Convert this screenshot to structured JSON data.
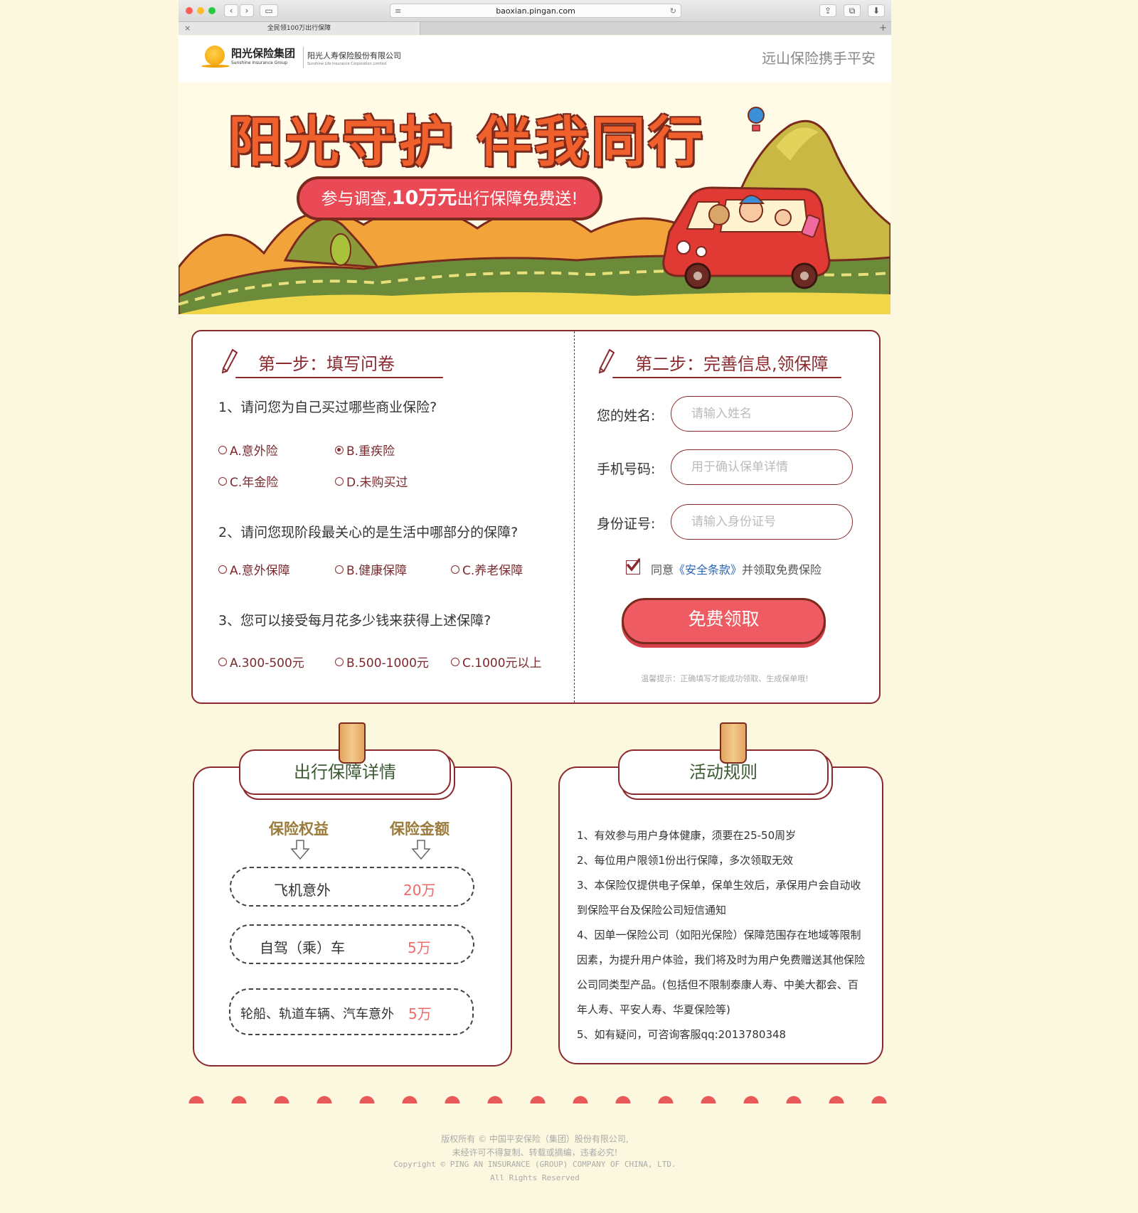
{
  "browser": {
    "address": "baoxian.pingan.com",
    "tab_title": "全民领100万出行保障",
    "tab_close": "×",
    "new_tab": "+"
  },
  "header": {
    "logo_name": "阳光保险集团",
    "logo_name_en": "Sunshine Insurance Group",
    "company": "阳光人寿保险股份有限公司",
    "company_en": "Sunshine Life Insurance Corporation Limited",
    "slogan": "远山保险携手平安"
  },
  "banner": {
    "title": "阳光守护 伴我同行",
    "pill_prefix": "参与调查,",
    "pill_amount": "10万元",
    "pill_suffix": "出行保障免费送!"
  },
  "step1": {
    "title": "第一步：填写问卷",
    "questions": [
      {
        "text": "1、请问您为自己买过哪些商业保险?",
        "options": [
          {
            "label": "A.意外险",
            "selected": false
          },
          {
            "label": "B.重疾险",
            "selected": true
          },
          {
            "label": "C.年金险",
            "selected": false
          },
          {
            "label": "D.未购买过",
            "selected": false
          }
        ]
      },
      {
        "text": "2、请问您现阶段最关心的是生活中哪部分的保障?",
        "options": [
          {
            "label": "A.意外保障",
            "selected": false
          },
          {
            "label": "B.健康保障",
            "selected": false
          },
          {
            "label": "C.养老保障",
            "selected": false
          }
        ]
      },
      {
        "text": "3、您可以接受每月花多少钱来获得上述保障?",
        "options": [
          {
            "label": "A.300-500元",
            "selected": false
          },
          {
            "label": "B.500-1000元",
            "selected": false
          },
          {
            "label": "C.1000元以上",
            "selected": false
          }
        ]
      }
    ]
  },
  "step2": {
    "title": "第二步：完善信息,领保障",
    "fields": [
      {
        "label": "您的姓名:",
        "value": "",
        "placeholder": "请输入姓名"
      },
      {
        "label": "手机号码:",
        "value": "",
        "placeholder": "用于确认保单详情"
      },
      {
        "label": "身份证号:",
        "value": "",
        "placeholder": "请输入身份证号"
      }
    ],
    "agree_prefix": "同意",
    "agree_link": "《安全条款》",
    "agree_suffix": "并领取免费保险",
    "agree_checked": true,
    "button": "免费领取",
    "tip": "温馨提示：正确填写才能成功领取、生成保单哦!"
  },
  "details": {
    "title": "出行保障详情",
    "col_benefit": "保险权益",
    "col_amount": "保险金额",
    "items": [
      {
        "name": "飞机意外",
        "amount": "20万"
      },
      {
        "name": "自驾（乘）车",
        "amount": "5万"
      },
      {
        "name": "轮船、轨道车辆、汽车意外",
        "amount": "5万"
      }
    ]
  },
  "rules": {
    "title": "活动规则",
    "lines": [
      "1、有效参与用户身体健康，须要在25-50周岁",
      "2、每位用户限领1份出行保障，多次领取无效",
      "3、本保险仅提供电子保单，保单生效后，承保用户会自动收到保险平台及保险公司短信通知",
      "4、因单一保险公司（如阳光保险）保障范围存在地域等限制因素，为提升用户体验，我们将及时为用户免费赠送其他保险公司同类型产品。(包括但不限制泰康人寿、中美大都会、百年人寿、平安人寿、华夏保险等)",
      "5、如有疑问，可咨询客服qq:2013780348"
    ]
  },
  "footer": {
    "line1": "版权所有 © 中国平安保险（集团）股份有限公司,",
    "line2": "未经许可不得复制、转载或摘编，违者必究!",
    "line3": "Copyright © PING AN INSURANCE (GROUP) COMPANY OF CHINA, LTD.",
    "line4": "All Rights Reserved"
  },
  "colors": {
    "page_bg": "#fcf8df",
    "accent": "#8b2a2e",
    "button": "#ef5b62",
    "amount": "#ef6b6b"
  }
}
